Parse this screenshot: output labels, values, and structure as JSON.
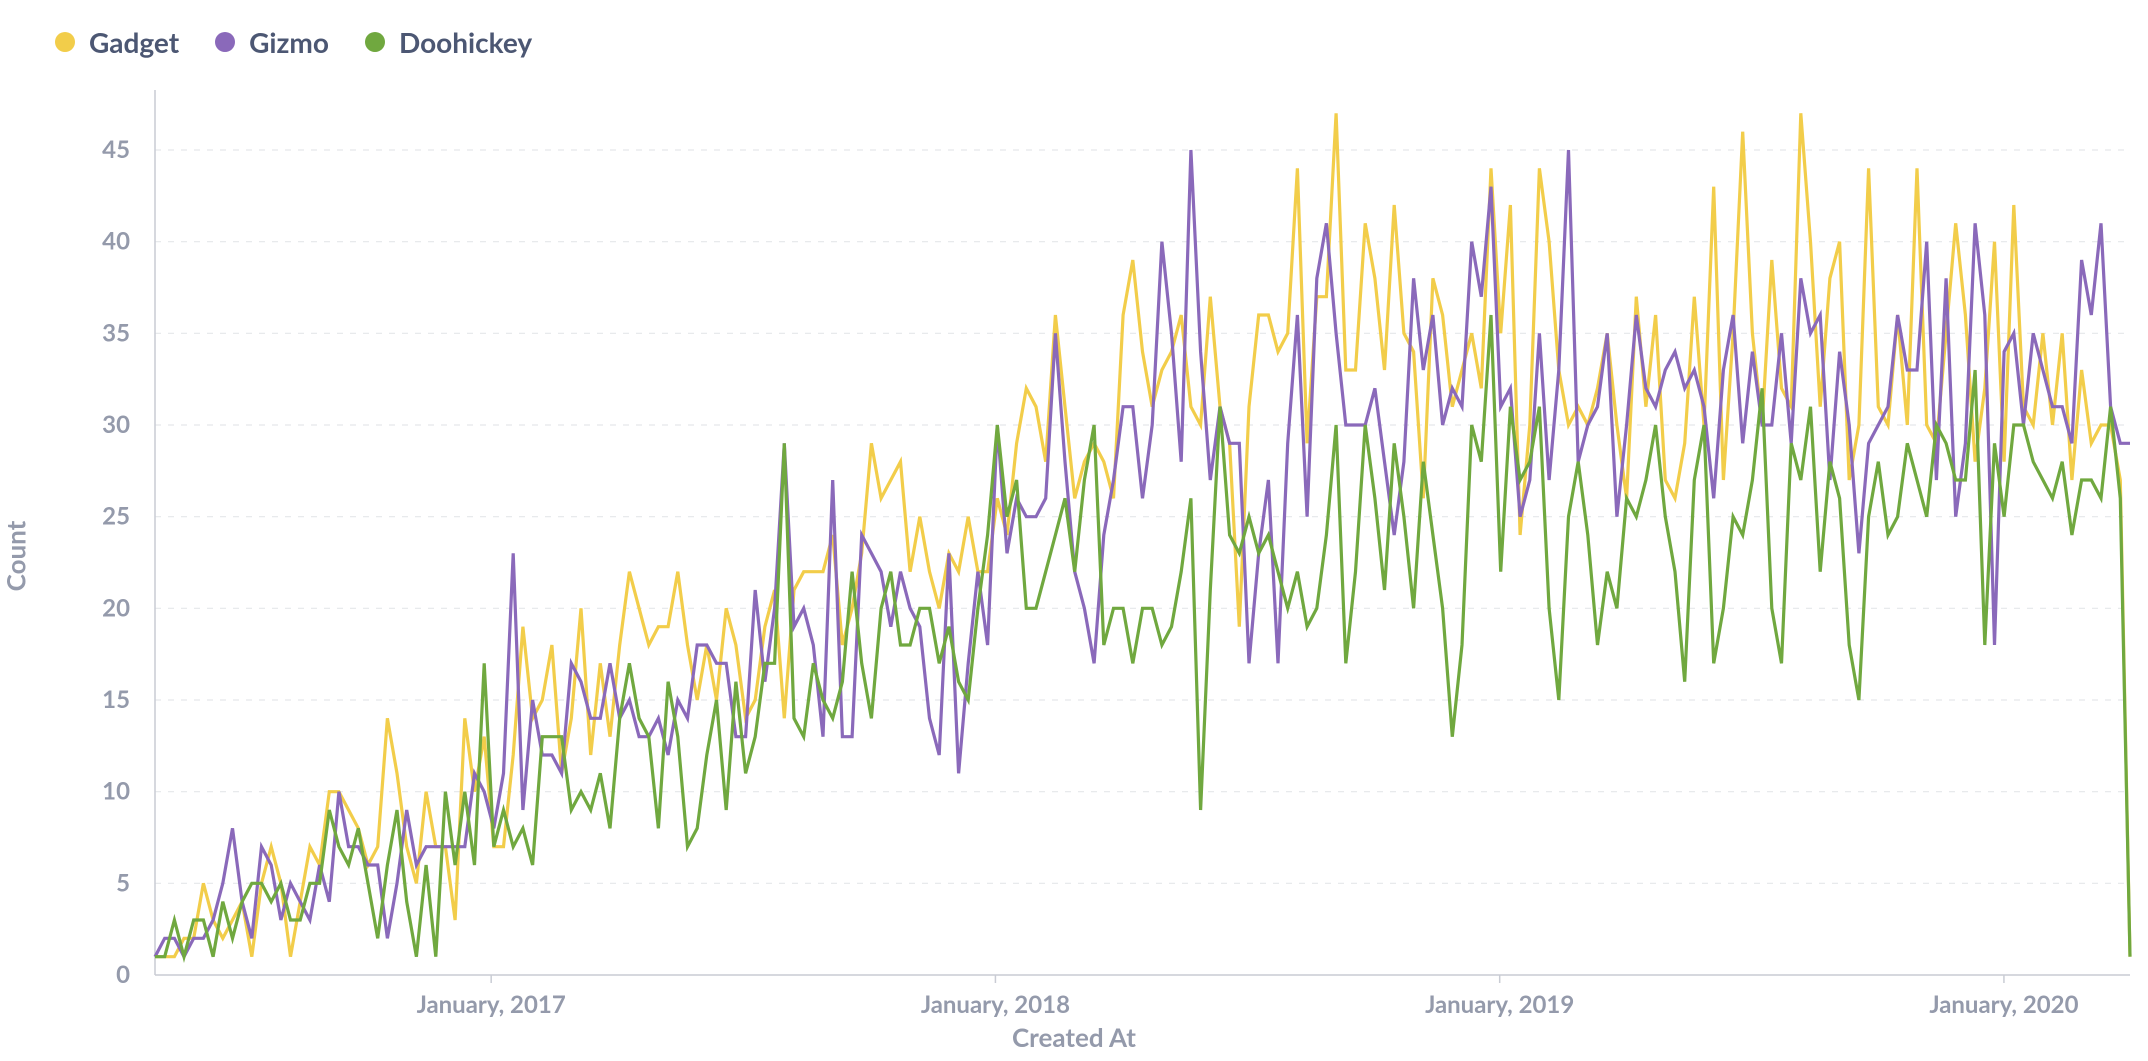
{
  "legend": {
    "items": [
      {
        "label": "Gadget",
        "color": "#f2cd4a"
      },
      {
        "label": "Gizmo",
        "color": "#8a69ba"
      },
      {
        "label": "Doohickey",
        "color": "#70a83f"
      }
    ]
  },
  "axes": {
    "xlabel": "Created At",
    "ylabel": "Count",
    "xticks": [
      "January, 2017",
      "January, 2018",
      "January, 2019",
      "January, 2020"
    ],
    "yticks": [
      0,
      5,
      10,
      15,
      20,
      25,
      30,
      35,
      40,
      45
    ]
  },
  "chart_data": {
    "type": "line",
    "title": "",
    "xlabel": "Created At",
    "ylabel": "Count",
    "ylim": [
      0,
      48
    ],
    "x_range": [
      "2016-05",
      "2020-04"
    ],
    "x_unit": "week",
    "x_count": 205,
    "xticks": [
      "January, 2017",
      "January, 2018",
      "January, 2019",
      "January, 2020"
    ],
    "series": [
      {
        "name": "Gadget",
        "color": "#f2cd4a",
        "values": [
          1,
          1,
          1,
          2,
          2,
          5,
          3,
          2,
          3,
          4,
          1,
          5,
          7,
          5,
          1,
          4,
          7,
          6,
          10,
          10,
          9,
          8,
          6,
          7,
          14,
          11,
          7,
          5,
          10,
          7,
          7,
          3,
          14,
          10,
          13,
          7,
          7,
          12,
          19,
          14,
          15,
          18,
          11,
          14,
          20,
          12,
          17,
          13,
          18,
          22,
          20,
          18,
          19,
          19,
          22,
          18,
          15,
          18,
          15,
          20,
          18,
          14,
          15,
          19,
          21,
          14,
          21,
          22,
          22,
          22,
          24,
          18,
          20,
          23,
          29,
          26,
          27,
          28,
          22,
          25,
          22,
          20,
          23,
          22,
          25,
          22,
          22,
          26,
          24,
          29,
          32,
          31,
          28,
          36,
          31,
          26,
          28,
          29,
          28,
          26,
          36,
          39,
          34,
          31,
          33,
          34,
          36,
          31,
          30,
          37,
          31,
          29,
          19,
          31,
          36,
          36,
          34,
          35,
          44,
          29,
          37,
          37,
          47,
          33,
          33,
          41,
          38,
          33,
          42,
          35,
          34,
          26,
          38,
          36,
          31,
          33,
          35,
          32,
          44,
          35,
          42,
          24,
          30,
          44,
          40,
          33,
          30,
          31,
          30,
          32,
          35,
          30,
          26,
          37,
          31,
          36,
          27,
          26,
          29,
          37,
          30,
          43,
          27,
          35,
          46,
          35,
          30,
          39,
          32,
          31,
          47,
          40,
          31,
          38,
          40,
          27,
          30,
          44,
          31,
          30,
          36,
          30,
          44,
          30,
          29,
          35,
          41,
          36,
          28,
          32,
          40,
          28,
          42,
          31,
          30,
          35,
          30,
          35,
          27,
          33,
          29,
          30,
          30,
          27,
          1
        ]
      },
      {
        "name": "Gizmo",
        "color": "#8a69ba",
        "values": [
          1,
          2,
          2,
          1,
          2,
          2,
          3,
          5,
          8,
          4,
          2,
          7,
          6,
          3,
          5,
          4,
          3,
          6,
          4,
          10,
          7,
          7,
          6,
          6,
          2,
          5,
          9,
          6,
          7,
          7,
          7,
          7,
          7,
          11,
          10,
          8,
          11,
          23,
          9,
          15,
          12,
          12,
          11,
          17,
          16,
          14,
          14,
          17,
          14,
          15,
          13,
          13,
          14,
          12,
          15,
          14,
          18,
          18,
          17,
          17,
          13,
          13,
          21,
          16,
          20,
          29,
          19,
          20,
          18,
          13,
          27,
          13,
          13,
          24,
          23,
          22,
          19,
          22,
          20,
          19,
          14,
          12,
          23,
          11,
          17,
          22,
          18,
          30,
          23,
          26,
          25,
          25,
          26,
          35,
          28,
          22,
          20,
          17,
          24,
          27,
          31,
          31,
          26,
          30,
          40,
          35,
          28,
          45,
          34,
          27,
          31,
          29,
          29,
          17,
          23,
          27,
          17,
          29,
          36,
          25,
          38,
          41,
          35,
          30,
          30,
          30,
          32,
          28,
          24,
          28,
          38,
          33,
          36,
          30,
          32,
          31,
          40,
          37,
          43,
          31,
          32,
          25,
          27,
          35,
          27,
          33,
          45,
          28,
          30,
          31,
          35,
          25,
          30,
          36,
          32,
          31,
          33,
          34,
          32,
          33,
          31,
          26,
          33,
          36,
          29,
          34,
          30,
          30,
          35,
          29,
          38,
          35,
          36,
          27,
          34,
          30,
          23,
          29,
          30,
          31,
          36,
          33,
          33,
          40,
          27,
          38,
          25,
          29,
          41,
          36,
          18,
          34,
          35,
          30,
          35,
          33,
          31,
          31,
          29,
          39,
          36,
          41,
          31,
          29,
          29
        ]
      },
      {
        "name": "Doohickey",
        "color": "#70a83f",
        "values": [
          1,
          1,
          3,
          1,
          3,
          3,
          1,
          4,
          2,
          4,
          5,
          5,
          4,
          5,
          3,
          3,
          5,
          5,
          9,
          7,
          6,
          8,
          5,
          2,
          6,
          9,
          4,
          1,
          6,
          1,
          10,
          6,
          10,
          6,
          17,
          7,
          9,
          7,
          8,
          6,
          13,
          13,
          13,
          9,
          10,
          9,
          11,
          8,
          14,
          17,
          14,
          13,
          8,
          16,
          13,
          7,
          8,
          12,
          15,
          9,
          16,
          11,
          13,
          17,
          17,
          29,
          14,
          13,
          17,
          15,
          14,
          16,
          22,
          17,
          14,
          20,
          22,
          18,
          18,
          20,
          20,
          17,
          19,
          16,
          15,
          20,
          24,
          30,
          25,
          27,
          20,
          20,
          22,
          24,
          26,
          22,
          27,
          30,
          18,
          20,
          20,
          17,
          20,
          20,
          18,
          19,
          22,
          26,
          9,
          21,
          31,
          24,
          23,
          25,
          23,
          24,
          22,
          20,
          22,
          19,
          20,
          24,
          30,
          17,
          22,
          30,
          26,
          21,
          29,
          25,
          20,
          28,
          24,
          20,
          13,
          18,
          30,
          28,
          36,
          22,
          31,
          27,
          28,
          31,
          20,
          15,
          25,
          28,
          24,
          18,
          22,
          20,
          26,
          25,
          27,
          30,
          25,
          22,
          16,
          27,
          30,
          17,
          20,
          25,
          24,
          27,
          32,
          20,
          17,
          29,
          27,
          31,
          22,
          28,
          26,
          18,
          15,
          25,
          28,
          24,
          25,
          29,
          27,
          25,
          30,
          29,
          27,
          27,
          33,
          18,
          29,
          25,
          30,
          30,
          28,
          27,
          26,
          28,
          24,
          27,
          27,
          26,
          31,
          26,
          1
        ]
      }
    ]
  }
}
